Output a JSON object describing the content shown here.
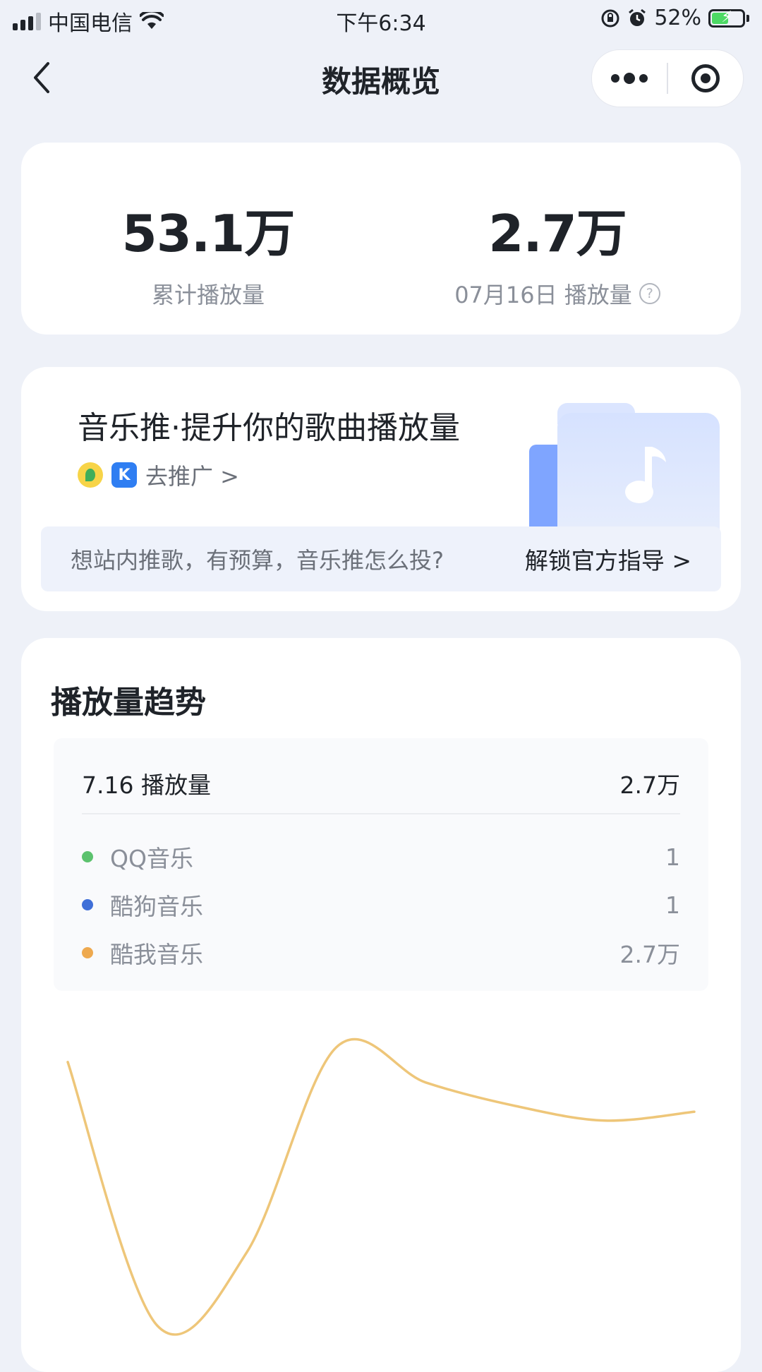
{
  "status_bar": {
    "carrier": "中国电信",
    "time": "下午6:34",
    "battery": "52%",
    "battery_level": 0.52
  },
  "nav": {
    "title": "数据概览"
  },
  "stats": {
    "total_value": "53.1万",
    "total_label": "累计播放量",
    "daily_value": "2.7万",
    "daily_label": "07月16日 播放量",
    "help_glyph": "?"
  },
  "promo": {
    "title": "音乐推·提升你的歌曲播放量",
    "link_label": "去推广 >",
    "kg_glyph": "K",
    "question": "想站内推歌，有预算，音乐推怎么投?",
    "cta": "解锁官方指导 >"
  },
  "trend": {
    "title": "播放量趋势",
    "tooltip": {
      "date_label": "7.16 播放量",
      "total": "2.7万",
      "rows": [
        {
          "name": "QQ音乐",
          "value": "1",
          "color": "#5cc26e"
        },
        {
          "name": "酷狗音乐",
          "value": "1",
          "color": "#3f6fd8"
        },
        {
          "name": "酷我音乐",
          "value": "2.7万",
          "color": "#eea94f"
        }
      ]
    }
  },
  "chart_data": {
    "type": "line",
    "series": [
      {
        "color": "#eec679",
        "values": [
          0.95,
          0.05,
          0.3,
          1.0,
          0.88,
          0.8,
          0.75,
          0.78
        ]
      }
    ]
  },
  "colors": {
    "accent_line": "#eec679",
    "page_bg": "#eef1f8"
  }
}
